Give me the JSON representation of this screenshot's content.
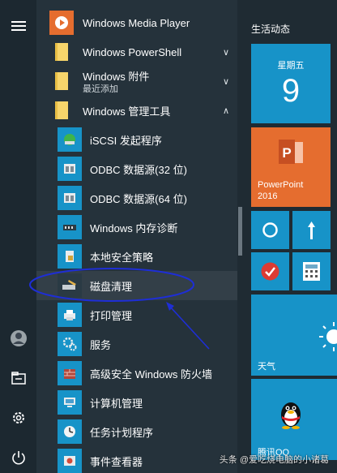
{
  "applist": {
    "items": [
      {
        "label": "Windows Media Player",
        "icon": "media-player-icon"
      },
      {
        "label": "Windows PowerShell",
        "icon": "folder-icon",
        "chevron": "∨"
      },
      {
        "label": "Windows 附件",
        "sublabel": "最近添加",
        "icon": "folder-icon",
        "chevron": "∨"
      },
      {
        "label": "Windows 管理工具",
        "icon": "folder-icon",
        "chevron": "∧"
      },
      {
        "label": "iSCSI 发起程序",
        "icon": "iscsi-icon"
      },
      {
        "label": "ODBC 数据源(32 位)",
        "icon": "odbc-icon"
      },
      {
        "label": "ODBC 数据源(64 位)",
        "icon": "odbc-icon"
      },
      {
        "label": "Windows 内存诊断",
        "icon": "memory-diagnostic-icon"
      },
      {
        "label": "本地安全策略",
        "icon": "security-policy-icon"
      },
      {
        "label": "磁盘清理",
        "icon": "disk-cleanup-icon"
      },
      {
        "label": "打印管理",
        "icon": "print-management-icon"
      },
      {
        "label": "服务",
        "icon": "services-icon"
      },
      {
        "label": "高级安全 Windows 防火墙",
        "icon": "firewall-icon"
      },
      {
        "label": "计算机管理",
        "icon": "computer-management-icon"
      },
      {
        "label": "任务计划程序",
        "icon": "task-scheduler-icon"
      },
      {
        "label": "事件查看器",
        "icon": "event-viewer-icon"
      }
    ]
  },
  "tiles": {
    "group_title": "生活动态",
    "calendar": {
      "day": "星期五",
      "date": "9"
    },
    "powerpoint": {
      "label_line1": "PowerPoint",
      "label_line2": "2016"
    },
    "weather": {
      "label": "天气"
    },
    "qq": {
      "label": "腾讯QQ"
    }
  },
  "watermark": {
    "prefix": "头条",
    "text": "@爱吃烧电脑的小诸葛"
  },
  "colors": {
    "tile_blue": "#1793c8",
    "tile_orange": "#e56d2f",
    "annotation": "#1e2ed6"
  }
}
